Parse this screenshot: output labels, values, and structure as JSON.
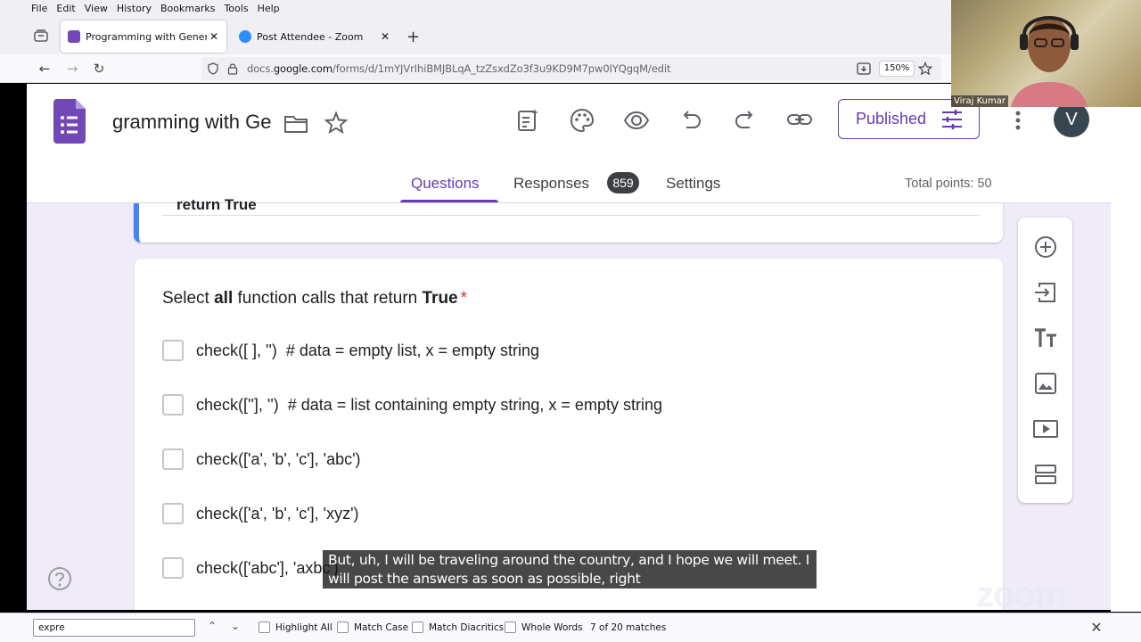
{
  "menubar": [
    "File",
    "Edit",
    "View",
    "History",
    "Bookmarks",
    "Tools",
    "Help"
  ],
  "tabs": [
    {
      "title": "Programming with Generative A",
      "close": "✕",
      "favicon_color": "#7248b9"
    },
    {
      "title": "Post Attendee - Zoom",
      "close": "✕",
      "favicon_color": "#2d8cff"
    }
  ],
  "new_tab": "+",
  "url": {
    "pre": "docs.",
    "domain": "google.com",
    "path": "/forms/d/1mYJVrIhiBMJBLqA_tzZsxdZo3f3u9KD9M7pw0IYQgqM/edit"
  },
  "zoom_level": "150%",
  "form": {
    "title": "gramming with Ge",
    "header_icons": [
      "quiz-ai-icon",
      "palette-icon",
      "preview-eye-icon",
      "undo-icon",
      "redo-icon",
      "link-icon"
    ],
    "published_label": "Published",
    "avatar_letter": "V",
    "tabs": {
      "questions": "Questions",
      "responses": "Responses",
      "settings": "Settings"
    },
    "responses_count": "859",
    "total_points": "Total points: 50",
    "prev_card_text": "return True",
    "question": {
      "pre": "Select ",
      "bold1": "all",
      "mid": " function calls that return ",
      "bold2": "True",
      "required": "*"
    },
    "options": [
      "check([ ], '')  # data = empty list, x = empty string",
      "check([''], '')  # data = list containing empty string, x = empty string",
      "check(['a', 'b', 'c'], 'abc')",
      "check(['a', 'b', 'c'], 'xyz')",
      "check(['abc'], 'axbc')"
    ],
    "sidebar_tools": [
      "add-question-icon",
      "import-questions-icon",
      "add-title-icon",
      "add-image-icon",
      "add-video-icon",
      "add-section-icon"
    ]
  },
  "caption": "But, uh, I will be traveling around the country, and I hope we will meet. I will post the answers as soon as possible, right",
  "findbar": {
    "query": "expre",
    "highlight_all": "Highlight All",
    "match_case": "Match Case",
    "match_diacritics": "Match Diacritics",
    "whole_words": "Whole Words",
    "count": "7 of 20 matches"
  },
  "webcam_name": "Viraj Kumar",
  "zoom_watermark": "zoom",
  "colors": {
    "accent": "#673ab7",
    "required": "#d93025",
    "card_border": "#4285f4"
  }
}
